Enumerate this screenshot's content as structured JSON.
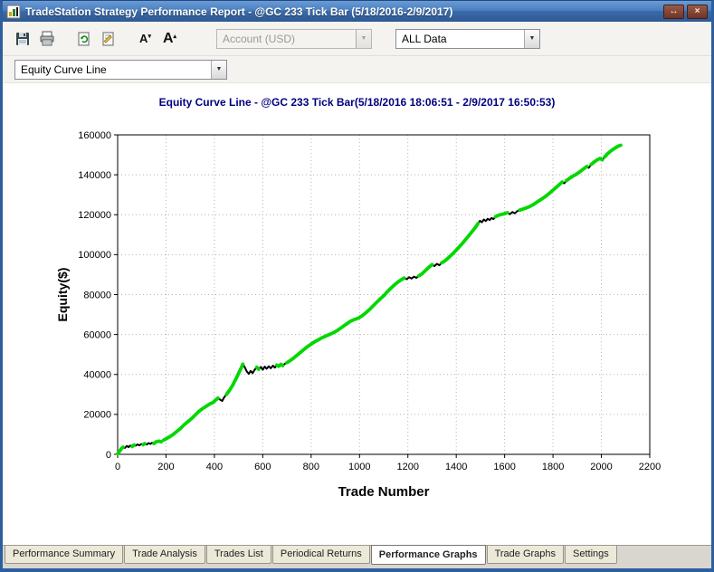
{
  "window": {
    "title": "TradeStation Strategy Performance Report - @GC 233 Tick Bar (5/18/2016-2/9/2017)",
    "restore_glyph": "↔",
    "close_glyph": "×"
  },
  "toolbar": {
    "icons": [
      "save-icon",
      "print-icon",
      "refresh-report-icon",
      "report-properties-icon",
      "decrease-font-icon",
      "increase-font-icon"
    ],
    "account_combo_value": "Account (USD)",
    "range_combo_value": "ALL Data"
  },
  "selector": {
    "value": "Equity Curve Line"
  },
  "chart": {
    "title": "Equity Curve Line - @GC 233 Tick Bar(5/18/2016 18:06:51 - 2/9/2017 16:50:53)"
  },
  "colors": {
    "curve_green": "#00d800",
    "drawdown": "#000000",
    "chart_title": "#000080"
  },
  "chart_data": {
    "type": "line",
    "title": "Equity Curve Line - @GC 233 Tick Bar(5/18/2016 18:06:51 - 2/9/2017 16:50:53)",
    "xlabel": "Trade Number",
    "ylabel": "Equity($)",
    "xlim": [
      0,
      2200
    ],
    "ylim": [
      0,
      160000
    ],
    "x_ticks": [
      0,
      200,
      400,
      600,
      800,
      1000,
      1200,
      1400,
      1600,
      1800,
      2000,
      2200
    ],
    "y_ticks": [
      0,
      20000,
      40000,
      60000,
      80000,
      100000,
      120000,
      140000,
      160000
    ],
    "grid": true,
    "legend": "none",
    "series": [
      {
        "name": "Equity",
        "color": "#00d800",
        "points": [
          [
            0,
            300
          ],
          [
            8,
            1500
          ],
          [
            15,
            2800
          ],
          [
            22,
            3600
          ],
          [
            30,
            3200
          ],
          [
            38,
            4200
          ],
          [
            45,
            3600
          ],
          [
            52,
            4400
          ],
          [
            60,
            3900
          ],
          [
            68,
            4700
          ],
          [
            75,
            4300
          ],
          [
            82,
            5000
          ],
          [
            90,
            4500
          ],
          [
            98,
            5200
          ],
          [
            105,
            4800
          ],
          [
            112,
            5400
          ],
          [
            120,
            4900
          ],
          [
            128,
            5600
          ],
          [
            135,
            5200
          ],
          [
            142,
            5800
          ],
          [
            150,
            5400
          ],
          [
            158,
            6200
          ],
          [
            170,
            6600
          ],
          [
            180,
            6300
          ],
          [
            190,
            7100
          ],
          [
            200,
            7800
          ],
          [
            215,
            8800
          ],
          [
            230,
            10000
          ],
          [
            245,
            11500
          ],
          [
            260,
            13000
          ],
          [
            275,
            14800
          ],
          [
            290,
            16300
          ],
          [
            305,
            17800
          ],
          [
            320,
            19600
          ],
          [
            335,
            21400
          ],
          [
            350,
            22800
          ],
          [
            365,
            24000
          ],
          [
            380,
            25200
          ],
          [
            395,
            26000
          ],
          [
            405,
            27200
          ],
          [
            415,
            28200
          ],
          [
            425,
            27300
          ],
          [
            432,
            26700
          ],
          [
            440,
            28500
          ],
          [
            450,
            30000
          ],
          [
            462,
            32000
          ],
          [
            475,
            34500
          ],
          [
            488,
            37500
          ],
          [
            500,
            40500
          ],
          [
            510,
            43000
          ],
          [
            518,
            45200
          ],
          [
            526,
            43500
          ],
          [
            534,
            41500
          ],
          [
            542,
            40300
          ],
          [
            550,
            41800
          ],
          [
            558,
            40600
          ],
          [
            566,
            42300
          ],
          [
            575,
            43600
          ],
          [
            583,
            42600
          ],
          [
            592,
            43800
          ],
          [
            600,
            42400
          ],
          [
            608,
            43900
          ],
          [
            616,
            42900
          ],
          [
            625,
            44100
          ],
          [
            633,
            43100
          ],
          [
            642,
            44400
          ],
          [
            650,
            43400
          ],
          [
            658,
            44700
          ],
          [
            666,
            44100
          ],
          [
            675,
            45100
          ],
          [
            683,
            44400
          ],
          [
            692,
            45400
          ],
          [
            700,
            45900
          ],
          [
            712,
            46800
          ],
          [
            725,
            48000
          ],
          [
            740,
            49500
          ],
          [
            755,
            51000
          ],
          [
            770,
            52500
          ],
          [
            785,
            54000
          ],
          [
            800,
            55200
          ],
          [
            815,
            56400
          ],
          [
            830,
            57400
          ],
          [
            845,
            58400
          ],
          [
            860,
            59200
          ],
          [
            875,
            60000
          ],
          [
            890,
            60800
          ],
          [
            905,
            61800
          ],
          [
            920,
            63000
          ],
          [
            935,
            64300
          ],
          [
            950,
            65600
          ],
          [
            965,
            66800
          ],
          [
            980,
            67600
          ],
          [
            995,
            68200
          ],
          [
            1010,
            69300
          ],
          [
            1025,
            70800
          ],
          [
            1040,
            72400
          ],
          [
            1055,
            74200
          ],
          [
            1070,
            76000
          ],
          [
            1085,
            77800
          ],
          [
            1100,
            79400
          ],
          [
            1115,
            81400
          ],
          [
            1130,
            83200
          ],
          [
            1145,
            84900
          ],
          [
            1160,
            86400
          ],
          [
            1175,
            87600
          ],
          [
            1185,
            88300
          ],
          [
            1195,
            87700
          ],
          [
            1205,
            88700
          ],
          [
            1215,
            88000
          ],
          [
            1225,
            89000
          ],
          [
            1235,
            88400
          ],
          [
            1245,
            89400
          ],
          [
            1258,
            90400
          ],
          [
            1272,
            92000
          ],
          [
            1286,
            93600
          ],
          [
            1300,
            95000
          ],
          [
            1310,
            94300
          ],
          [
            1320,
            95400
          ],
          [
            1330,
            94700
          ],
          [
            1340,
            95900
          ],
          [
            1352,
            96800
          ],
          [
            1366,
            98200
          ],
          [
            1380,
            99800
          ],
          [
            1395,
            101600
          ],
          [
            1410,
            103600
          ],
          [
            1425,
            105600
          ],
          [
            1440,
            107800
          ],
          [
            1455,
            110000
          ],
          [
            1468,
            112000
          ],
          [
            1480,
            113800
          ],
          [
            1490,
            115600
          ],
          [
            1498,
            117000
          ],
          [
            1506,
            116200
          ],
          [
            1514,
            117600
          ],
          [
            1522,
            116800
          ],
          [
            1530,
            118000
          ],
          [
            1538,
            117300
          ],
          [
            1546,
            118400
          ],
          [
            1554,
            117800
          ],
          [
            1562,
            119000
          ],
          [
            1572,
            119600
          ],
          [
            1585,
            120100
          ],
          [
            1600,
            120500
          ],
          [
            1612,
            121000
          ],
          [
            1622,
            120300
          ],
          [
            1632,
            121400
          ],
          [
            1642,
            120700
          ],
          [
            1652,
            121800
          ],
          [
            1662,
            122300
          ],
          [
            1675,
            122800
          ],
          [
            1690,
            123400
          ],
          [
            1705,
            124200
          ],
          [
            1720,
            125200
          ],
          [
            1735,
            126400
          ],
          [
            1750,
            127600
          ],
          [
            1765,
            128800
          ],
          [
            1780,
            130200
          ],
          [
            1795,
            131800
          ],
          [
            1810,
            133400
          ],
          [
            1825,
            135000
          ],
          [
            1838,
            136400
          ],
          [
            1846,
            135700
          ],
          [
            1855,
            137000
          ],
          [
            1868,
            138200
          ],
          [
            1880,
            139200
          ],
          [
            1895,
            140200
          ],
          [
            1910,
            141400
          ],
          [
            1925,
            142800
          ],
          [
            1940,
            144200
          ],
          [
            1948,
            143500
          ],
          [
            1958,
            145200
          ],
          [
            1970,
            146400
          ],
          [
            1982,
            147400
          ],
          [
            1994,
            148200
          ],
          [
            2004,
            147500
          ],
          [
            2014,
            149000
          ],
          [
            2026,
            150600
          ],
          [
            2040,
            152000
          ],
          [
            2055,
            153300
          ],
          [
            2070,
            154400
          ],
          [
            2080,
            154800
          ]
        ]
      }
    ],
    "drawdown_color": "#000000",
    "drawdown_ranges": [
      [
        24,
        60
      ],
      [
        70,
        105
      ],
      [
        112,
        150
      ],
      [
        176,
        192
      ],
      [
        420,
        445
      ],
      [
        518,
        575
      ],
      [
        583,
        655
      ],
      [
        680,
        702
      ],
      [
        1183,
        1250
      ],
      [
        1302,
        1345
      ],
      [
        1492,
        1560
      ],
      [
        1615,
        1660
      ],
      [
        1835,
        1858
      ],
      [
        1942,
        1962
      ],
      [
        2000,
        2018
      ]
    ]
  },
  "tabs": [
    {
      "label": "Performance Summary",
      "active": false
    },
    {
      "label": "Trade Analysis",
      "active": false
    },
    {
      "label": "Trades List",
      "active": false
    },
    {
      "label": "Periodical Returns",
      "active": false
    },
    {
      "label": "Performance Graphs",
      "active": true
    },
    {
      "label": "Trade Graphs",
      "active": false
    },
    {
      "label": "Settings",
      "active": false
    }
  ]
}
